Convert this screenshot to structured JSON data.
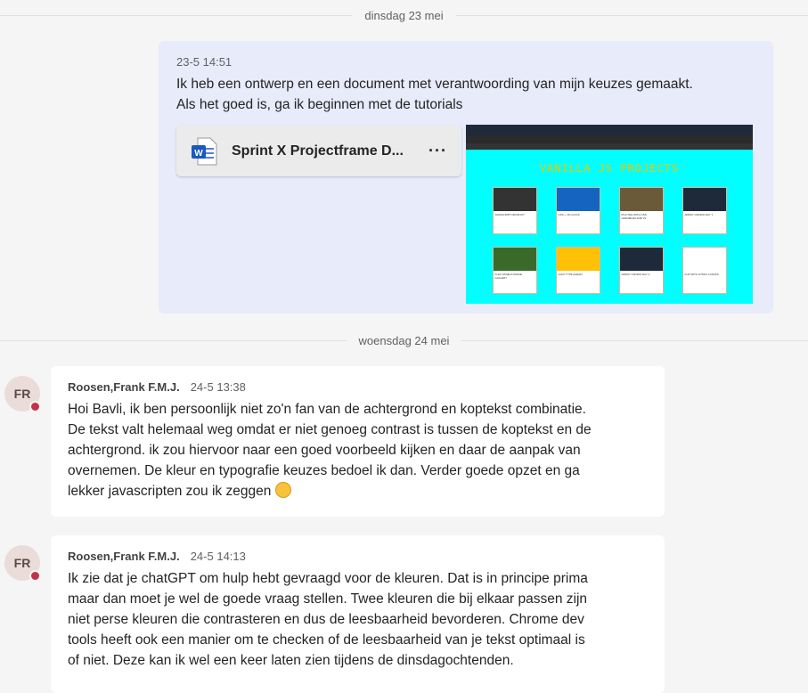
{
  "dividers": [
    "dinsdag 23 mei",
    "woensdag 24 mei"
  ],
  "own_message": {
    "timestamp": "23-5 14:51",
    "lines": [
      "Ik heb een ontwerp en een document met verantwoording van mijn keuzes gemaakt.",
      "Als het goed is, ga ik beginnen met de tutorials"
    ],
    "file": {
      "icon": "word-doc-icon",
      "name": "Sprint X Projectframe D...",
      "more": "···"
    },
    "screenshot": {
      "title": "VANILLA JS PROJECTS",
      "cards": [
        "JAVASCRIPT DRUM KIT",
        "CSS + JS CLOCK",
        "PLAYING WITH CSS VARIABLES AND JS",
        "ARRAY CARDIO DAY 1",
        "FLEX PANELS IMAGE GALLERY",
        "AJAX TYPE AHEAD",
        "ARRAY CARDIO DAY 2",
        "FUN WITH HTML5 CANVAS"
      ]
    }
  },
  "messages": [
    {
      "initials": "FR",
      "author": "Roosen,Frank F.M.J.",
      "timestamp": "24-5 13:38",
      "lines": [
        "Hoi Bavli, ik ben persoonlijk niet zo'n fan van de achtergrond en koptekst combinatie.",
        "De tekst valt helemaal weg omdat er niet genoeg contrast is tussen de koptekst en de",
        "achtergrond. ik zou hiervoor naar een goed voorbeeld kijken en daar de aanpak van",
        "overnemen. De kleur en typografie keuzes bedoel ik dan. Verder goede opzet en ga",
        "lekker javascripten zou ik zeggen"
      ],
      "emoji": "smiling-face-icon"
    },
    {
      "initials": "FR",
      "author": "Roosen,Frank F.M.J.",
      "timestamp": "24-5 14:13",
      "lines": [
        "Ik zie dat je chatGPT om hulp hebt gevraagd voor de kleuren. Dat is in principe prima",
        "maar dan moet je wel de goede vraag stellen. Twee kleuren die bij elkaar passen zijn",
        "niet perse kleuren die contrasteren en dus de leesbaarheid bevorderen. Chrome dev",
        "tools heeft ook een manier om te checken of de leesbaarheid van je tekst optimaal is",
        "of niet. Deze kan ik wel een keer laten zien tijdens de dinsdagochtenden."
      ]
    }
  ],
  "colors": {
    "own_bubble": "#e8ebfa",
    "presence_busy": "#c4314b",
    "thumb_bg": "#00ffff",
    "thumb_title": "#e6c800"
  }
}
